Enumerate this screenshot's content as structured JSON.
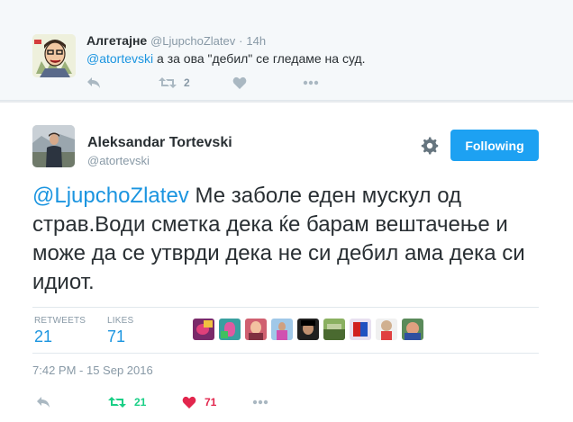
{
  "parent_tweet": {
    "author_name": "Алгетајне",
    "screen_name": "@LjupchoZlatev",
    "separator": "·",
    "time": "14h",
    "mention": "@atortevski",
    "text": " а за ова \"дебил\" се гледаме на суд.",
    "retweet_count": "2",
    "icons": [
      "reply-icon",
      "retweet-icon",
      "heart-icon",
      "more-icon"
    ]
  },
  "main_tweet": {
    "author_name": "Aleksandar Tortevski",
    "screen_name": "@atortevski",
    "follow_label": "Following",
    "mention": "@LjupchoZlatev",
    "text": " Ме заболе еден мускул од страв.Води сметка дека ќе барам вештачење и може да се утврди дека не си дебил ама дека си идиот.",
    "retweets_label": "RETWEETS",
    "retweets": "21",
    "likes_label": "LIKES",
    "likes": "71",
    "liker_count_shown": 9,
    "timestamp": "7:42 PM - 15 Sep 2016",
    "retweet_count": "21",
    "like_count": "71",
    "icons": [
      "gear-icon",
      "reply-icon",
      "retweet-icon",
      "heart-icon",
      "more-icon"
    ]
  },
  "colors": {
    "link": "#1b95e0",
    "button": "#1da1f2",
    "retweet_active": "#19cf86",
    "like_active": "#e2264d",
    "muted": "#8899a6",
    "icon_gray": "#aab8c2"
  }
}
